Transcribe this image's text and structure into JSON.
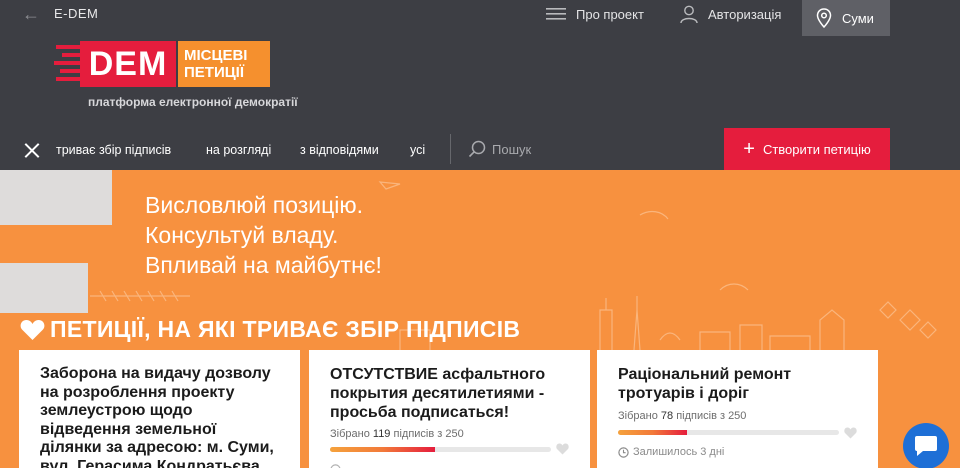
{
  "top": {
    "brand": "E-DEM",
    "about": "Про проект",
    "auth": "Авторизація",
    "city": "Суми"
  },
  "logo": {
    "dem": "DEM",
    "line1": "МІСЦЕВІ",
    "line2": "ПЕТИЦІЇ",
    "tagline": "платформа електронної демократії"
  },
  "nav": {
    "tabs": [
      "триває збір підписів",
      "на розгляді",
      "з відповідями",
      "усі"
    ],
    "search_placeholder": "Пошук",
    "create_label": "Створити петицію"
  },
  "hero": {
    "lines": [
      "Висловлюй позицію.",
      "Консультуй владу.",
      "Впливай на майбутнє!"
    ],
    "section_title": "ПЕТИЦІЇ, НА ЯКІ ТРИВАЄ ЗБІР ПІДПИСІВ"
  },
  "petitions": [
    {
      "title": "Заборона на видачу дозволу на розроблення проекту землеустрою щодо відведення земельної ділянки за адресою: м. Суми, вул. Герасима Кондратьєва,"
    },
    {
      "title": "ОТСУТСТВИЕ асфальтного покрытия десятилетиями - просьба подписаться!",
      "signed_prefix": "Зібрано",
      "signed_count": "119",
      "signed_suffix": "підписів з 250",
      "progress": 0.476
    },
    {
      "title": "Раціональний ремонт тротуарів і доріг",
      "signed_prefix": "Зібрано",
      "signed_count": "78",
      "signed_suffix": "підписів з 250",
      "progress": 0.312,
      "days_left": "Залишилось 3 дні"
    }
  ],
  "colors": {
    "dark": "#3d3e44",
    "red": "#e51d3d",
    "orange": "#f7913f",
    "chat": "#1e6fd6"
  }
}
